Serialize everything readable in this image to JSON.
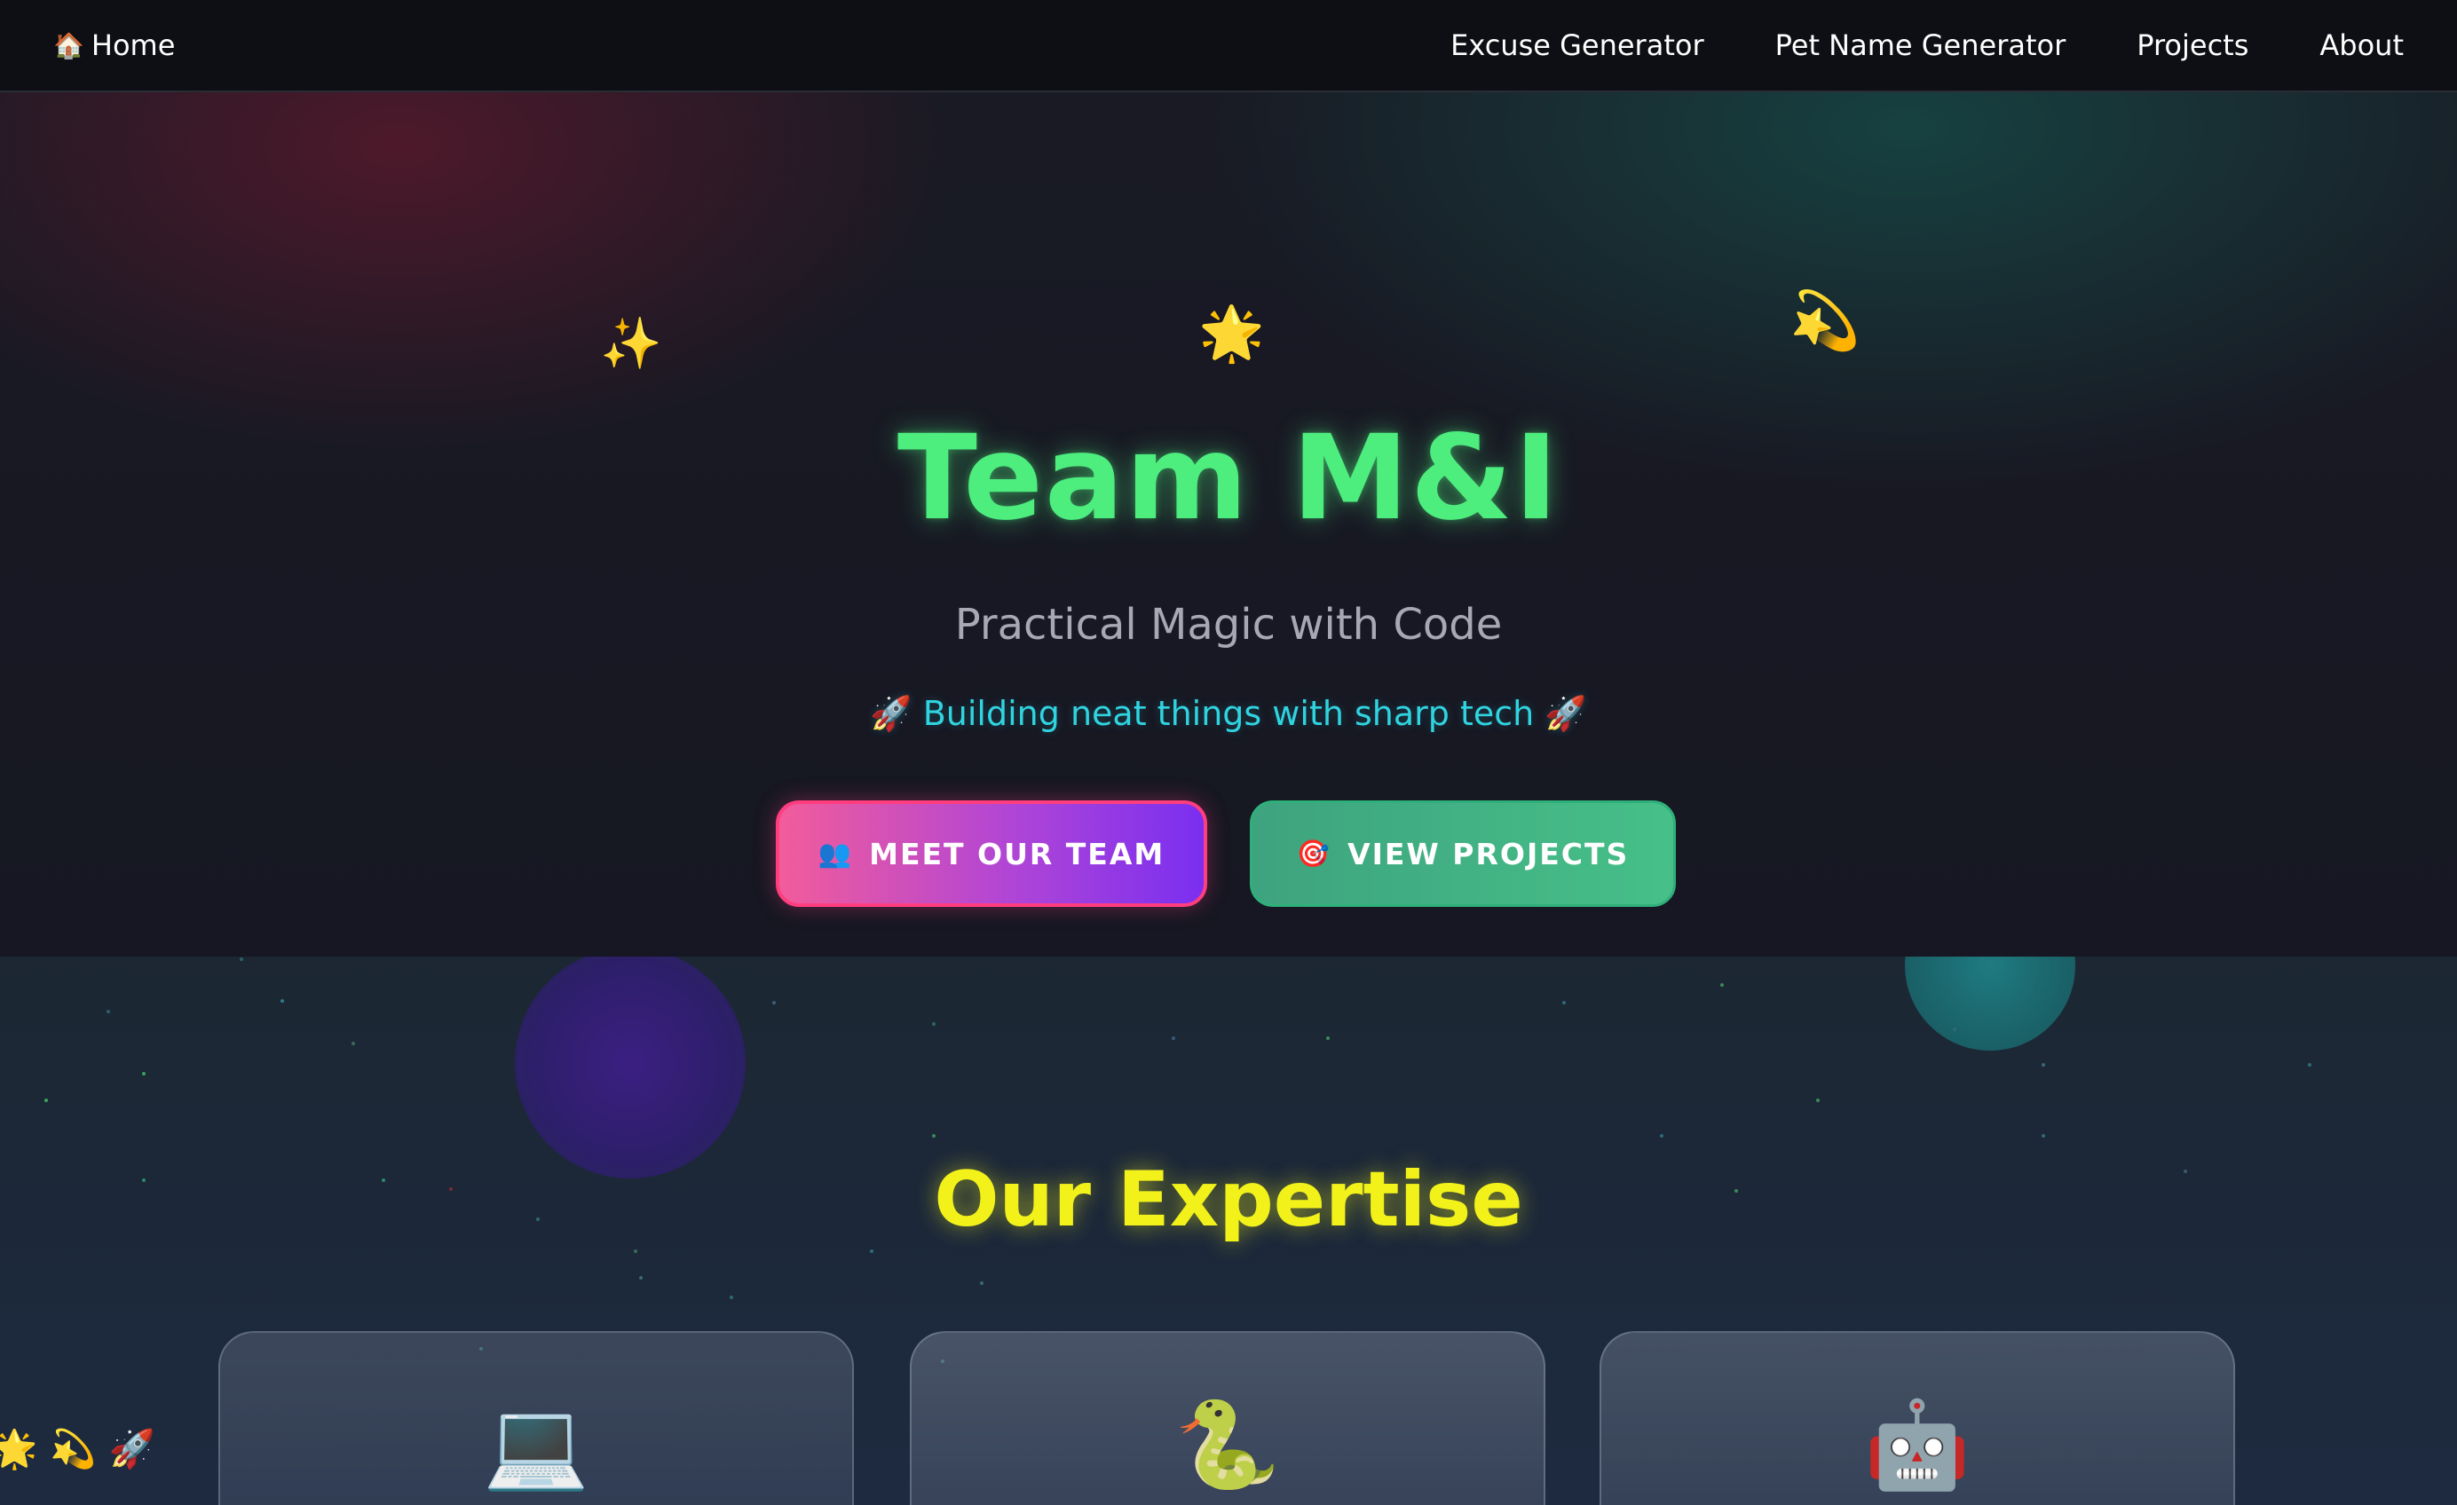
{
  "nav": {
    "home_icon": "house-emoji",
    "home_emoji": "🏠",
    "home_label": "Home",
    "links": [
      {
        "label": "Excuse Generator"
      },
      {
        "label": "Pet Name Generator"
      },
      {
        "label": "Projects"
      },
      {
        "label": "About"
      }
    ]
  },
  "hero": {
    "title": "Team M&I",
    "subtitle": "Practical Magic with Code",
    "tagline": "🚀 Building neat things with sharp tech 🚀",
    "sparkles": [
      "✨",
      "🌟",
      "💫"
    ],
    "buttons": {
      "team": {
        "emoji": "👥",
        "label": "MEET OUR TEAM"
      },
      "projects": {
        "emoji": "🎯",
        "label": "VIEW PROJECTS"
      }
    }
  },
  "expertise": {
    "title": "Our Expertise",
    "cards": [
      {
        "icon_name": "laptop-icon",
        "emoji": "💻"
      },
      {
        "icon_name": "snake-icon",
        "emoji": "🐍"
      },
      {
        "icon_name": "robot-icon",
        "emoji": "🤖"
      }
    ],
    "floaters": [
      "🌟",
      "💫",
      "🚀"
    ]
  },
  "colors": {
    "title_green": "#4ded7e",
    "tagline_cyan": "#2fd4e0",
    "section_title_yellow": "#f2f21a",
    "team_button_border": "#ff3d7f",
    "projects_button": "#46c088"
  }
}
